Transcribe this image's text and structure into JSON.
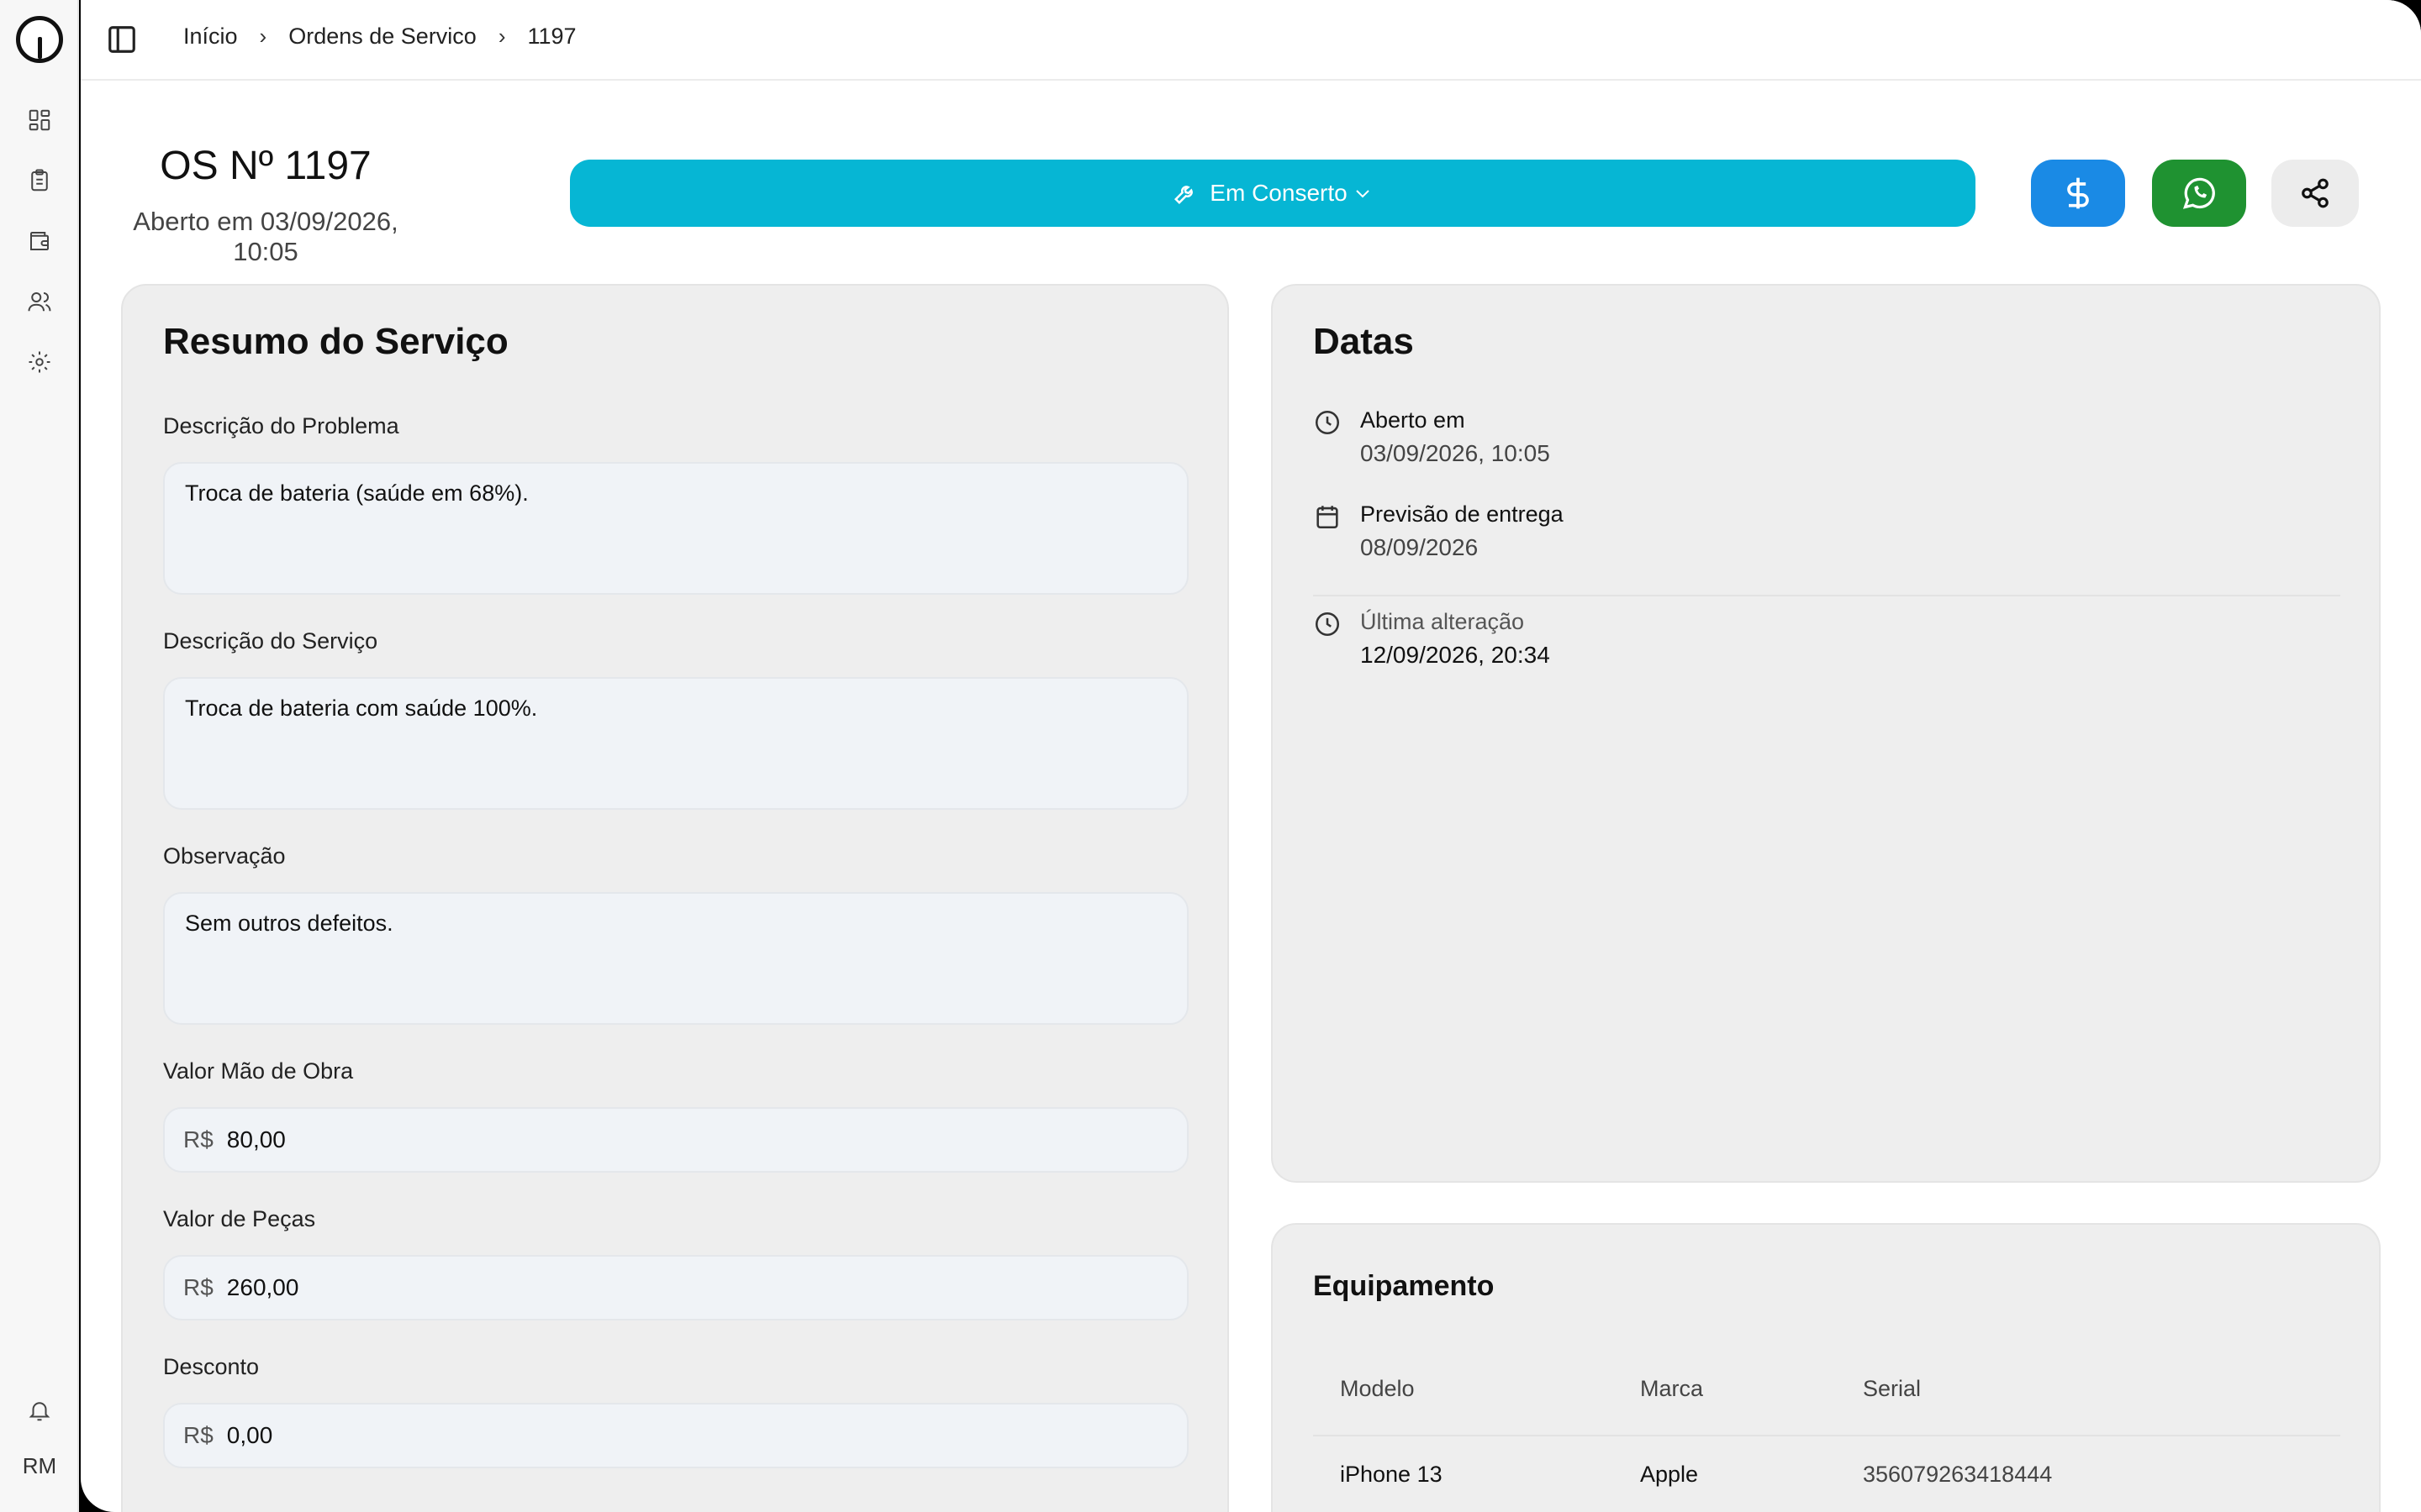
{
  "sidebar": {
    "user_initials": "RM"
  },
  "breadcrumb": {
    "items": [
      "Início",
      "Ordens de Servico",
      "1197"
    ],
    "separator": "›"
  },
  "header": {
    "title": "OS Nº 1197",
    "opened": "Aberto em 03/09/2026, 10:05",
    "status_label": "Em Conserto"
  },
  "colors": {
    "status": "#06b6d4",
    "money_button": "#1a8ae5",
    "whatsapp_button": "#1f9231"
  },
  "resumo": {
    "title": "Resumo do Serviço",
    "problema_label": "Descrição do Problema",
    "problema_value": "Troca de bateria (saúde em 68%).",
    "servico_label": "Descrição do Serviço",
    "servico_value": "Troca de bateria com saúde 100%.",
    "observacao_label": "Observação",
    "observacao_value": "Sem outros defeitos.",
    "currency_prefix": "R$",
    "mao_obra_label": "Valor Mão de Obra",
    "mao_obra_value": "80,00",
    "pecas_label": "Valor de Peças",
    "pecas_value": "260,00",
    "desconto_label": "Desconto",
    "desconto_value": "0,00"
  },
  "datas": {
    "title": "Datas",
    "aberto_label": "Aberto em",
    "aberto_value": "03/09/2026, 10:05",
    "previsao_label": "Previsão de entrega",
    "previsao_value": "08/09/2026",
    "alteracao_label": "Última alteração",
    "alteracao_value": "12/09/2026, 20:34"
  },
  "equipamento": {
    "title": "Equipamento",
    "columns": [
      "Modelo",
      "Marca",
      "Serial"
    ],
    "rows": [
      {
        "modelo": "iPhone 13",
        "marca": "Apple",
        "serial": "356079263418444"
      }
    ]
  }
}
